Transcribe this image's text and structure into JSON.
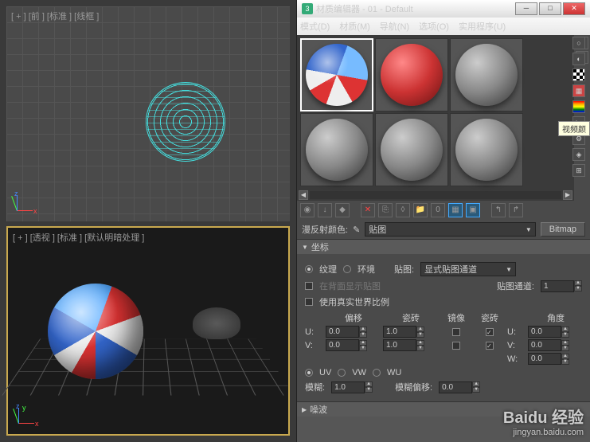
{
  "window": {
    "title": "材质编辑器 - 01 - Default"
  },
  "menu": {
    "mode": "模式(D)",
    "material": "材质(M)",
    "nav": "导航(N)",
    "options": "选项(O)",
    "util": "实用程序(U)"
  },
  "viewport": {
    "top": "[ + ] [前 ] [标准 ] [线框 ]",
    "bot": "[ + ] [透视 ] [标准 ] [默认明暗处理 ]",
    "axes": {
      "x": "x",
      "y": "y",
      "z": "z"
    }
  },
  "tooltip": "视频颜",
  "diffuse": {
    "label": "漫反射颜色:",
    "mapName": "贴图",
    "mapBtn": "Bitmap"
  },
  "coords": {
    "title": "坐标",
    "texture": "纹理",
    "environ": "环境",
    "mapLabel": "贴图:",
    "mapMode": "显式贴图通道",
    "backface": "在背面显示贴图",
    "channelLabel": "贴图通道:",
    "channel": "1",
    "realworld": "使用真实世界比例",
    "hdr": {
      "offset": "偏移",
      "tiling": "瓷砖",
      "mirror": "镜像",
      "tile": "瓷砖",
      "angle": "角度"
    },
    "u": "U:",
    "v": "V:",
    "w": "W:",
    "uOff": "0.0",
    "vOff": "0.0",
    "uTile": "1.0",
    "vTile": "1.0",
    "uAng": "0.0",
    "vAng": "0.0",
    "wAng": "0.0",
    "uv": "UV",
    "vw": "VW",
    "wu": "WU",
    "blurLabel": "模糊:",
    "blur": "1.0",
    "blurOffLabel": "模糊偏移:",
    "blurOff": "0.0"
  },
  "noise": {
    "title": "噪波"
  },
  "watermark": {
    "logo": "Baidu 经验",
    "url": "jingyan.baidu.com"
  }
}
